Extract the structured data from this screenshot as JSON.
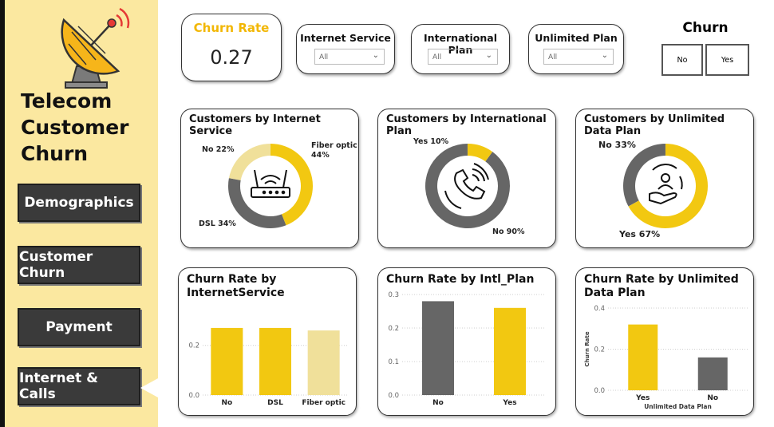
{
  "sidebar": {
    "title": "Telecom\nCustomer\nChurn",
    "nav": [
      {
        "label": "Demographics"
      },
      {
        "label": "Customer Churn"
      },
      {
        "label": "Payment"
      },
      {
        "label": "Internet & Calls"
      }
    ]
  },
  "kpi": {
    "label": "Churn Rate",
    "value": "0.27"
  },
  "slicers": [
    {
      "label": "Internet Service",
      "value": "All"
    },
    {
      "label": "International Plan",
      "value": "All"
    },
    {
      "label": "Unlimited Plan",
      "value": "All"
    }
  ],
  "churn_filter": {
    "title": "Churn",
    "options": [
      "No",
      "Yes"
    ]
  },
  "colors": {
    "yellow": "#f2c811",
    "gray": "#666666",
    "pale": "#f0e09a",
    "accent": "#f2b705"
  },
  "donuts": {
    "internet": {
      "title": "Customers by Internet Service",
      "labels": {
        "fiber": "Fiber optic\n44%",
        "no": "No 22%",
        "dsl": "DSL 34%"
      },
      "icon": "wifi-router-icon"
    },
    "intl": {
      "title": "Customers by International Plan",
      "labels": {
        "yes": "Yes 10%",
        "no": "No 90%"
      },
      "icon": "phone-call-icon"
    },
    "unlimited": {
      "title": "Customers by Unlimited Data Plan",
      "labels": {
        "no": "No 33%",
        "yes": "Yes 67%"
      },
      "icon": "customer-service-icon"
    }
  },
  "chart_data": [
    {
      "type": "pie",
      "title": "Customers by Internet Service",
      "categories": [
        "Fiber optic",
        "DSL",
        "No"
      ],
      "values": [
        44,
        34,
        22
      ]
    },
    {
      "type": "pie",
      "title": "Customers by International Plan",
      "categories": [
        "No",
        "Yes"
      ],
      "values": [
        90,
        10
      ]
    },
    {
      "type": "pie",
      "title": "Customers by Unlimited Data Plan",
      "categories": [
        "Yes",
        "No"
      ],
      "values": [
        67,
        33
      ]
    },
    {
      "type": "bar",
      "title": "Churn Rate by\nInternetService",
      "categories": [
        "No",
        "DSL",
        "Fiber optic"
      ],
      "values": [
        0.27,
        0.27,
        0.26
      ],
      "yticks": [
        "0.0",
        "0.2"
      ],
      "ylim": [
        0,
        0.35
      ]
    },
    {
      "type": "bar",
      "title": "Churn Rate by Intl_Plan",
      "categories": [
        "No",
        "Yes"
      ],
      "values": [
        0.28,
        0.26
      ],
      "yticks": [
        "0.0",
        "0.1",
        "0.2",
        "0.3"
      ],
      "ylim": [
        0,
        0.3
      ]
    },
    {
      "type": "bar",
      "title": "Churn Rate by Unlimited\nData Plan",
      "categories": [
        "Yes",
        "No"
      ],
      "values": [
        0.32,
        0.16
      ],
      "yticks": [
        "0.0",
        "0.2",
        "0.4"
      ],
      "ylim": [
        0,
        0.4
      ],
      "xlabel": "Unlimited Data Plan",
      "ylabel": "Churn Rate"
    }
  ]
}
